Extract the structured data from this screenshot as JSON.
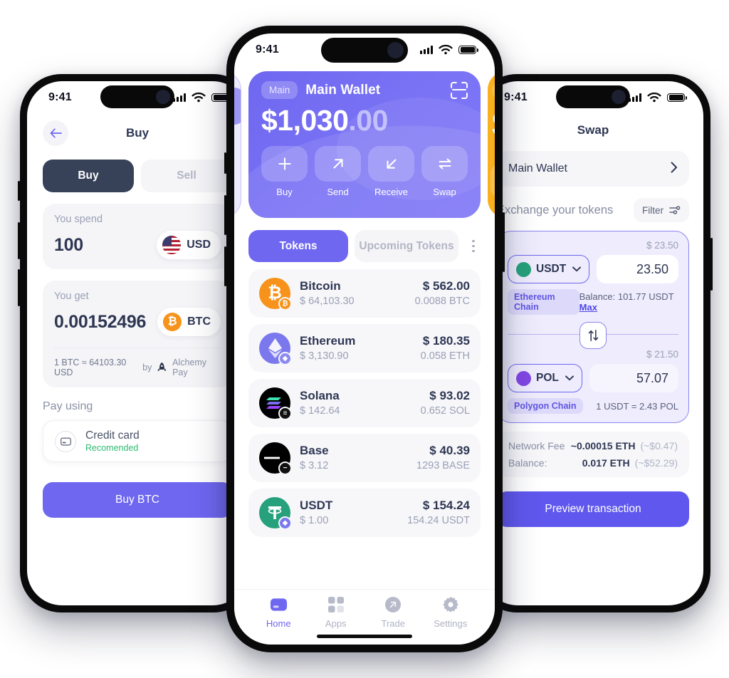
{
  "status_bar": {
    "time": "9:41",
    "signal_icon": "cellular-bars-icon",
    "wifi_icon": "wifi-icon",
    "battery_icon": "battery-icon"
  },
  "center_phone": {
    "wallet_card": {
      "badge": "Main",
      "name": "Main Wallet",
      "scan_icon": "scan-qr-icon",
      "balance_whole": "$1,030",
      "balance_cents": ".00",
      "card_color": "#6F67F0",
      "actions": [
        {
          "label": "Buy",
          "icon": "plus-icon"
        },
        {
          "label": "Send",
          "icon": "arrow-up-right-icon"
        },
        {
          "label": "Receive",
          "icon": "arrow-down-left-icon"
        },
        {
          "label": "Swap",
          "icon": "swap-horizontal-icon"
        }
      ],
      "next_card_color": "#F9B01E"
    },
    "tabs": {
      "active": "Tokens",
      "inactive": "Upcoming Tokens",
      "more_icon": "kebab-menu-icon"
    },
    "tokens": [
      {
        "name": "Bitcoin",
        "price": "$ 64,103.30",
        "value": "$ 562.00",
        "amount": "0.0088 BTC",
        "symbol": "₿",
        "color": "#F7931A",
        "chip_color": "#F7931A",
        "chip_symbol": "₿"
      },
      {
        "name": "Ethereum",
        "price": "$ 3,130.90",
        "value": "$ 180.35",
        "amount": "0.058 ETH",
        "symbol": "◆",
        "color": "#7B78EE",
        "chip_color": "#8C8AF0",
        "chip_symbol": "◆"
      },
      {
        "name": "Solana",
        "price": "$ 142.64",
        "value": "$ 93.02",
        "amount": "0.652 SOL",
        "symbol": "≡",
        "color": "#000000",
        "chip_color": "#111111",
        "chip_symbol": "≡"
      },
      {
        "name": "Base",
        "price": "$ 3.12",
        "value": "$ 40.39",
        "amount": "1293 BASE",
        "symbol": "—",
        "color": "#000000",
        "chip_color": "#111111",
        "chip_symbol": "—"
      },
      {
        "name": "USDT",
        "price": "$ 1.00",
        "value": "$ 154.24",
        "amount": "154.24 USDT",
        "symbol": "₮",
        "color": "#26A17B",
        "chip_color": "#7B78EE",
        "chip_symbol": "◆"
      }
    ],
    "bottom_nav": [
      {
        "label": "Home",
        "icon": "wallet-icon",
        "active": true
      },
      {
        "label": "Apps",
        "icon": "grid-icon",
        "active": false
      },
      {
        "label": "Trade",
        "icon": "trade-icon",
        "active": false
      },
      {
        "label": "Settings",
        "icon": "gear-icon",
        "active": false
      }
    ]
  },
  "left_phone": {
    "back_icon": "back-arrow-icon",
    "title": "Buy",
    "segments": {
      "buy": "Buy",
      "sell": "Sell"
    },
    "spend": {
      "label": "You spend",
      "value": "100",
      "currency": "USD",
      "flag_icon": "us-flag-icon"
    },
    "get": {
      "label": "You get",
      "value": "0.00152496",
      "currency": "BTC",
      "coin_icon": "bitcoin-icon"
    },
    "rate": "1 BTC  ≈  64103.30 USD",
    "provider_prefix": "by",
    "provider": "Alchemy Pay",
    "provider_icon": "rocket-icon",
    "pay_label": "Pay using",
    "pay_method": {
      "title": "Credit card",
      "subtitle": "Recomended",
      "icon": "credit-card-icon"
    },
    "cta": "Buy BTC"
  },
  "right_phone": {
    "title": "Swap",
    "wallet": "Main Wallet",
    "wallet_chevron_icon": "chevron-right-icon",
    "exchange_title": "Exchange your tokens",
    "filter": {
      "label": "Filter",
      "icon": "filter-sliders-icon"
    },
    "from": {
      "usd": "$ 23.50",
      "token": "USDT",
      "amount": "23.50",
      "chain": "Ethereum Chain",
      "balance": "Balance: 101.77 USDT",
      "max": "Max",
      "chevron_icon": "chevron-down-icon",
      "token_color": "#26A17B"
    },
    "switch_icon": "swap-vertical-icon",
    "to": {
      "usd": "$ 21.50",
      "token": "POL",
      "amount": "57.07",
      "chain": "Polygon Chain",
      "rate": "1 USDT = 2.43 POL",
      "chevron_icon": "chevron-down-icon",
      "token_color": "#8247E5"
    },
    "fees": [
      {
        "label": "Network Fee",
        "value": "~0.00015 ETH",
        "secondary": "(~$0.47)"
      },
      {
        "label": "Balance:",
        "value": "0.017 ETH",
        "secondary": "(~$52.29)"
      }
    ],
    "cta": "Preview transaction"
  }
}
